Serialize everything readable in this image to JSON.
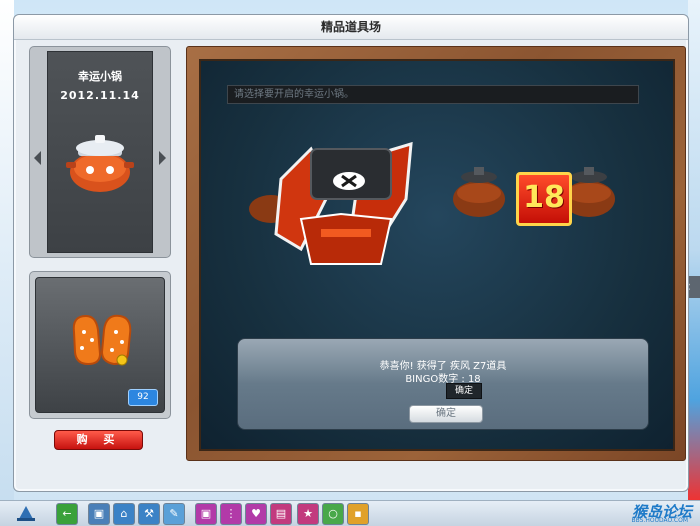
{
  "window": {
    "title": "精品道具场"
  },
  "item_card": {
    "name": "幸运小锅",
    "date": "2012.11.14"
  },
  "reward": {
    "quantity": "92",
    "buy_label": "购 买"
  },
  "board": {
    "select_placeholder": "请选择要开启的幸运小锅。",
    "bingo_number": "18"
  },
  "dialog": {
    "line1": "恭喜你! 获得了 疾风 Z7道具",
    "line2": "BINGO数字 : 18",
    "tooltip": "确定",
    "ok_label": "确定"
  },
  "taskbar": {
    "logo": "猴岛论坛",
    "logo_sub": "BBS.HOUDAO.COM"
  },
  "colors": {
    "accent_red": "#c40f06",
    "number_yellow": "#ffe85a",
    "board_bg": "#17303f"
  }
}
